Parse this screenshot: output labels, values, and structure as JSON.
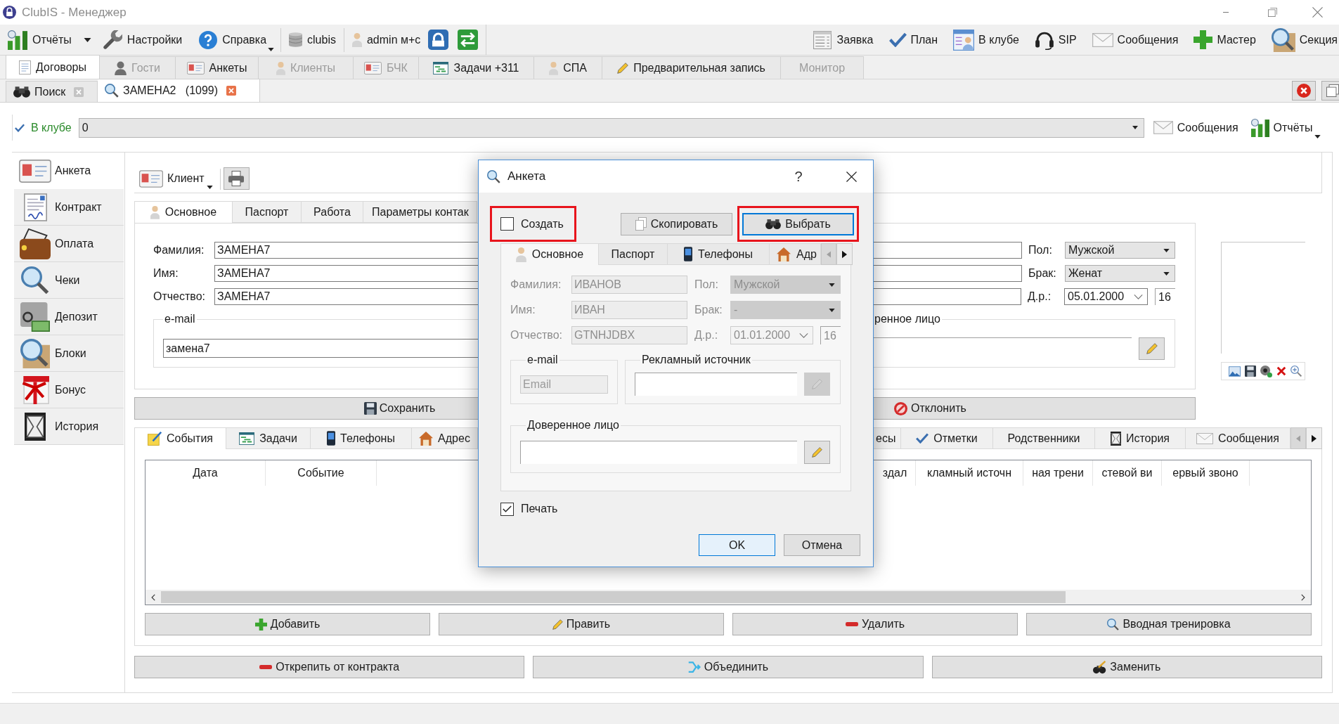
{
  "window": {
    "title": "ClubIS - Менеджер"
  },
  "toolbar": {
    "left_items": [
      "Отчёты",
      "Настройки",
      "Справка",
      "clubis",
      "admin м+с"
    ],
    "right_items": [
      "Заявка",
      "План",
      "В клубе",
      "SIP",
      "Сообщения",
      "Мастер",
      "Секция"
    ]
  },
  "module_tabs": [
    {
      "label": "Договоры",
      "selected": true,
      "disabled": false
    },
    {
      "label": "Гости",
      "selected": false,
      "disabled": true
    },
    {
      "label": "Анкеты",
      "selected": false,
      "disabled": false
    },
    {
      "label": "Клиенты",
      "selected": false,
      "disabled": true
    },
    {
      "label": "БЧК",
      "selected": false,
      "disabled": true
    },
    {
      "label": "Задачи +311",
      "selected": false,
      "disabled": false
    },
    {
      "label": "СПА",
      "selected": false,
      "disabled": false
    },
    {
      "label": "Предварительная запись",
      "selected": false,
      "disabled": false
    },
    {
      "label": "Монитор",
      "selected": false,
      "disabled": true
    }
  ],
  "document_tabs": [
    {
      "label": "Поиск",
      "selected": false
    },
    {
      "label": "ЗАМЕНА2   (1099)",
      "selected": true
    }
  ],
  "filter_bar": {
    "label": "В клубе",
    "value": "0",
    "buttons": [
      "Сообщения",
      "Отчёты"
    ]
  },
  "sidebar": {
    "items": [
      {
        "label": "Анкета",
        "selected": true
      },
      {
        "label": "Контракт",
        "selected": false
      },
      {
        "label": "Оплата",
        "selected": false
      },
      {
        "label": "Чеки",
        "selected": false
      },
      {
        "label": "Депозит",
        "selected": false
      },
      {
        "label": "Блоки",
        "selected": false
      },
      {
        "label": "Бонус",
        "selected": false
      },
      {
        "label": "История",
        "selected": false
      }
    ]
  },
  "client_menu": "Клиент",
  "form_tabs": [
    {
      "label": "Основное",
      "selected": true
    },
    {
      "label": "Паспорт",
      "selected": false
    },
    {
      "label": "Работа",
      "selected": false
    },
    {
      "label": "Параметры контак",
      "selected": false
    }
  ],
  "form": {
    "name_fields": [
      {
        "label": "Фамилия:",
        "value": "ЗАМЕНА7"
      },
      {
        "label": "Имя:",
        "value": "ЗАМЕНА7"
      },
      {
        "label": "Отчество:",
        "value": "ЗАМЕНА7"
      }
    ],
    "gender": {
      "label": "Пол:",
      "value": "Мужской"
    },
    "marital_status": {
      "label": "Брак:",
      "value": "Женат"
    },
    "birth_date": {
      "label": "Д.р.:",
      "value": "05.01.2000",
      "age": "16"
    },
    "email_group": {
      "title": "e-mail",
      "value": "замена7"
    },
    "trustee_group": {
      "title": "ренное лицо"
    }
  },
  "save_button": "Сохранить",
  "reject_button": "Отклонить",
  "event_tabs": [
    {
      "label": "События",
      "selected": true
    },
    {
      "label": "Задачи",
      "selected": false
    },
    {
      "label": "Телефоны",
      "selected": false
    },
    {
      "label": "Адрес",
      "selected": false
    },
    {
      "label": "есы",
      "selected": false
    },
    {
      "label": "Отметки",
      "selected": false
    },
    {
      "label": "Родственники",
      "selected": false
    },
    {
      "label": "История",
      "selected": false
    },
    {
      "label": "Сообщения",
      "selected": false
    }
  ],
  "events_table": {
    "columns": [
      "Дата",
      "Событие",
      "здал",
      "кламный источн",
      "ная трени",
      "стевой ви",
      "ервый звоно"
    ]
  },
  "event_buttons": [
    "Добавить",
    "Править",
    "Удалить",
    "Вводная тренировка"
  ],
  "bottom_buttons": [
    "Открепить от контракта",
    "Объединить",
    "Заменить"
  ],
  "dialog": {
    "title": "Анкета",
    "help_button": "?",
    "create_option": {
      "label": "Создать",
      "checked": false,
      "highlighted": true
    },
    "actions": [
      {
        "label": "Скопировать",
        "highlighted": false,
        "focused": false
      },
      {
        "label": "Выбрать",
        "highlighted": true,
        "focused": true
      }
    ],
    "tabs": [
      {
        "label": "Основное",
        "selected": true
      },
      {
        "label": "Паспорт",
        "selected": false
      },
      {
        "label": "Телефоны",
        "selected": false
      },
      {
        "label": "Адр",
        "selected": false
      }
    ],
    "name_fields": [
      {
        "label": "Фамилия:",
        "value": "ИВАНОВ",
        "disabled": true
      },
      {
        "label": "Имя:",
        "value": "ИВАН",
        "disabled": true
      },
      {
        "label": "Отчество:",
        "value": "GTNHJDBX",
        "disabled": true
      }
    ],
    "gender": {
      "label": "Пол:",
      "value": "Мужской",
      "disabled": true
    },
    "marital_status": {
      "label": "Брак:",
      "value": "-",
      "disabled": true
    },
    "birth_date": {
      "label": "Д.р.:",
      "value": "01.01.2000",
      "age": "16",
      "disabled": true
    },
    "email_group": {
      "title": "e-mail",
      "placeholder": "Email",
      "disabled": true
    },
    "ad_source_group": {
      "title": "Рекламный источник",
      "edit_disabled": true
    },
    "trustee_group": {
      "title": "Доверенное лицо",
      "edit_disabled": false
    },
    "print_option": {
      "label": "Печать",
      "checked": true
    },
    "buttons": [
      {
        "label": "OK",
        "default": true
      },
      {
        "label": "Отмена",
        "default": false
      }
    ]
  }
}
